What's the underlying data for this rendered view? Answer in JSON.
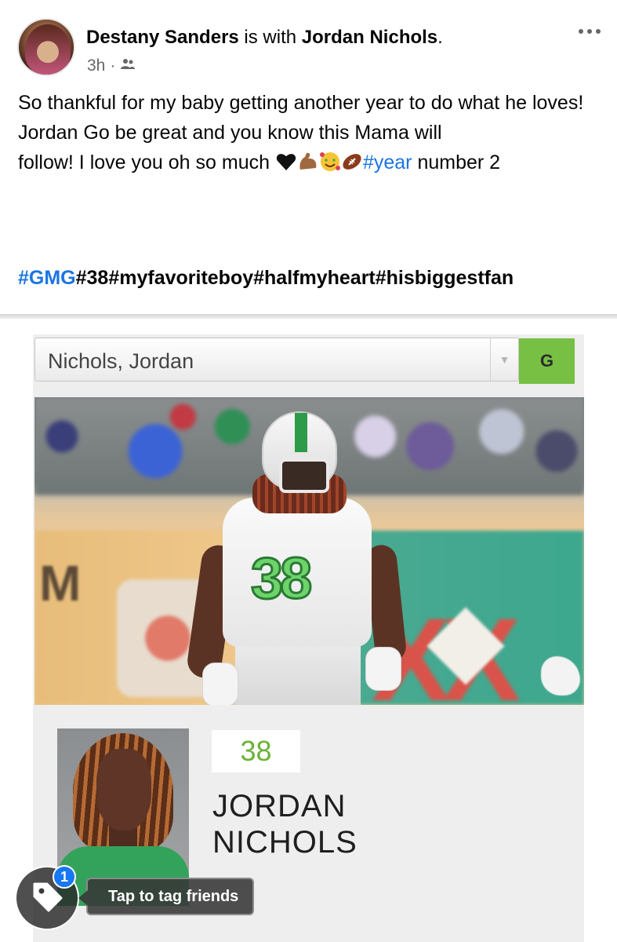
{
  "post": {
    "author": "Destany Sanders",
    "with_text": " is with ",
    "tagged_user": "Jordan Nichols",
    "period": ".",
    "timestamp": "3h",
    "separator": " · ",
    "audience_icon": "friends-icon",
    "text_line1": "So thankful for my baby getting another year to do what he loves!",
    "text_line2": "Jordan Go be great and you know this Mama will",
    "text_line3_start": "follow!  I love you oh so much ",
    "text_line3_hashtag": "#year",
    "text_line3_end": " number 2",
    "emojis": [
      "black-heart-emoji",
      "flexed-biceps-emoji",
      "smiling-face-with-hearts-emoji",
      "american-football-emoji"
    ],
    "hashtags_linked": "#GMG",
    "hashtags_rest": "#38#myfavoriteboy#halfmyheart#hisbiggestfan"
  },
  "photo": {
    "select_value": "Nichols, Jordan",
    "go_label": "G",
    "jersey_number": "38",
    "name_line1": "JORDAN",
    "name_line2": "NICHOLS",
    "wall_letter": "M",
    "wall_graphic": "XX"
  },
  "overlay": {
    "tag_badge_count": "1",
    "tooltip": "Tap to tag friends"
  },
  "colors": {
    "hashtag": "#1b74e4",
    "go_button": "#77c043",
    "badge": "#1877f2"
  }
}
